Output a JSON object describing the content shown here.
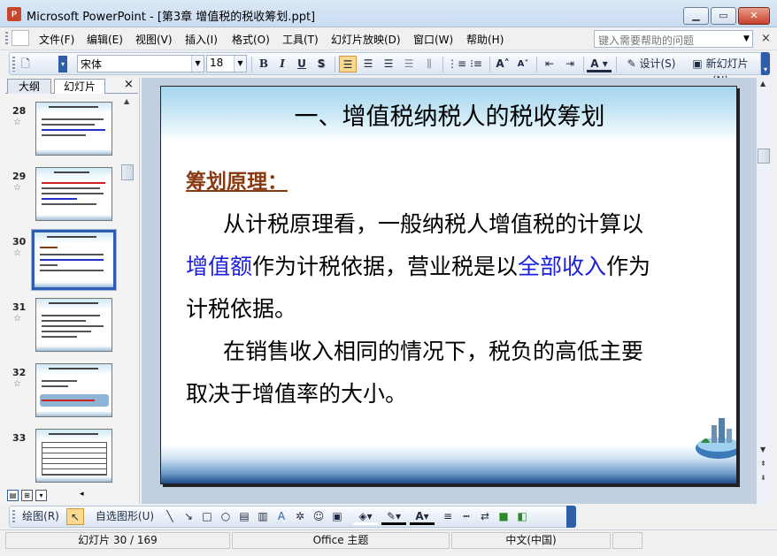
{
  "window": {
    "title": "Microsoft PowerPoint - [第3章 增值税的税收筹划.ppt]",
    "app_icon_text": "P"
  },
  "menu": {
    "items": [
      "文件(F)",
      "编辑(E)",
      "视图(V)",
      "插入(I)",
      "格式(O)",
      "工具(T)",
      "幻灯片放映(D)",
      "窗口(W)",
      "帮助(H)"
    ],
    "help_placeholder": "键入需要帮助的问题"
  },
  "toolbar": {
    "font_name": "宋体",
    "font_size": "18",
    "bold": "B",
    "italic": "I",
    "underline": "U",
    "shadow": "S",
    "design_label": "设计(S)",
    "new_slide_label": "新幻灯片(N)"
  },
  "panel": {
    "tab_outline": "大纲",
    "tab_slides": "幻灯片",
    "close": "×",
    "slides": [
      {
        "number": "28"
      },
      {
        "number": "29"
      },
      {
        "number": "30",
        "selected": true
      },
      {
        "number": "31"
      },
      {
        "number": "32"
      },
      {
        "number": "33"
      }
    ]
  },
  "slide": {
    "title": "一、增值税纳税人的税收筹划",
    "subheading": "筹划原理：",
    "para1_line1": "从计税原理看，一般纳税人增值税的计算以",
    "para1_line2_a": "增值额",
    "para1_line2_b": "作为计税依据，营业税是以",
    "para1_line2_c": "全部收入",
    "para1_line2_d": "作为",
    "para1_line3": "计税依据。",
    "para2_line1": "在销售收入相同的情况下，税负的高低主要",
    "para2_line2": "取决于增值率的大小。"
  },
  "drawbar": {
    "draw_label": "绘图(R)",
    "autoshapes_label": "自选图形(U)"
  },
  "status": {
    "slide_position": "幻灯片 30 / 169",
    "theme": "Office 主题",
    "language": "中文(中国)"
  },
  "colors": {
    "accent_blue": "#1a1ee0",
    "subheading_brown": "#8a3a12",
    "selection_border": "#2c5db0"
  }
}
